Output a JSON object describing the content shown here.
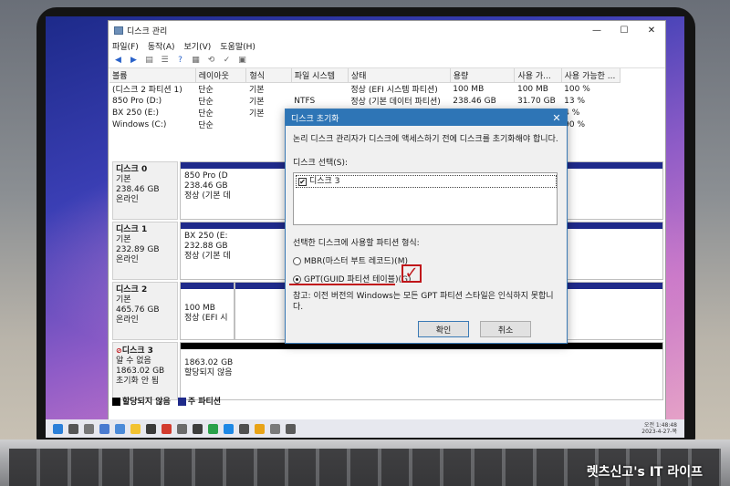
{
  "window": {
    "title": "디스크 관리",
    "controls": [
      "—",
      "☐",
      "✕"
    ]
  },
  "menu": [
    "파일(F)",
    "동작(A)",
    "보기(V)",
    "도움말(H)"
  ],
  "table": {
    "headers": [
      "볼륨",
      "레이아웃",
      "형식",
      "파일 시스템",
      "상태",
      "용량",
      "사용 가...",
      "사용 가능한 ..."
    ],
    "rows": [
      [
        "(디스크 2 파티션 1)",
        "단순",
        "기본",
        "",
        "정상 (EFI 시스템 파티션)",
        "100 MB",
        "100 MB",
        "100 %"
      ],
      [
        "850 Pro (D:)",
        "단순",
        "기본",
        "NTFS",
        "정상 (기본 데이터 파티션)",
        "238.46 GB",
        "31.70 GB",
        "13 %"
      ],
      [
        "BX 250 (E:)",
        "단순",
        "기본",
        "",
        "",
        "",
        "",
        "4 %"
      ],
      [
        "Windows (C:)",
        "단순",
        "",
        "",
        "",
        "",
        "",
        "90 %"
      ]
    ]
  },
  "disks": [
    {
      "name": "디스크 0",
      "type": "기본",
      "size": "238.46 GB",
      "status": "온라인",
      "part_title": "850 Pro (D",
      "part_size": "238.46 GB",
      "part_status": "정상 (기본 데"
    },
    {
      "name": "디스크 1",
      "type": "기본",
      "size": "232.89 GB",
      "status": "온라인",
      "part_title": "BX 250 (E:",
      "part_size": "232.88 GB",
      "part_status": "정상 (기본 데"
    },
    {
      "name": "디스크 2",
      "type": "기본",
      "size": "465.76 GB",
      "status": "온라인",
      "part_title": "",
      "part_size": "100 MB",
      "part_status": "정상 (EFI 시"
    },
    {
      "name": "디스크 3",
      "type": "알 수 없음",
      "size": "1863.02 GB",
      "status": "초기화 안 됨",
      "part_title": "",
      "part_size": "1863.02 GB",
      "part_status": "할당되지 않음"
    }
  ],
  "legend": {
    "unallocated": "할당되지 않음",
    "primary": "주 파티션"
  },
  "dialog": {
    "title": "디스크 초기화",
    "message": "논리 디스크 관리자가 디스크에 액세스하기 전에 디스크를 초기화해야 합니다.",
    "select_label": "디스크 선택(S):",
    "disk_item": "디스크 3",
    "style_label": "선택한 디스크에 사용할 파티션 형식:",
    "mbr_option": "MBR(마스터 부트 레코드)(M)",
    "gpt_option": "GPT(GUID 파티션 테이블)(G)",
    "note": "참고: 이전 버전의 Windows는 모든 GPT 파티션 스타일은 인식하지 못합니다.",
    "ok": "확인",
    "cancel": "취소",
    "selected": "gpt"
  },
  "taskbar": {
    "time": "오전 1:48:48",
    "date": "2023-4-27-목"
  },
  "watermark": "렛츠신고's IT 라이프",
  "colors": {
    "primary_partition": "#1f2a8a",
    "unallocated": "#000000",
    "dialog_title": "#2e75b6",
    "annotation": "#c0151a"
  }
}
